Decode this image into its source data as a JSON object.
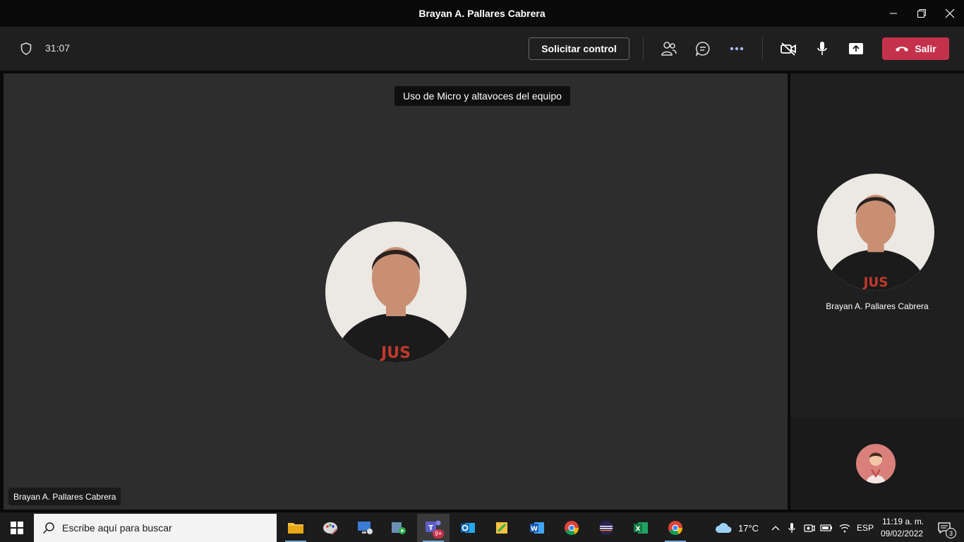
{
  "window": {
    "title": "Brayan A. Pallares Cabrera"
  },
  "toolbar": {
    "timer": "31:07",
    "request_control_label": "Solicitar control",
    "leave_label": "Salir"
  },
  "stage": {
    "tooltip": "Uso de Micro y altavoces del equipo",
    "participant_name": "Brayan A. Pallares Cabrera"
  },
  "side_panel": {
    "participant_name": "Brayan A. Pallares Cabrera"
  },
  "taskbar": {
    "search_placeholder": "Escribe aquí para buscar",
    "teams_badge": "9+",
    "weather": "17°C",
    "language": "ESP",
    "time": "11:19 a. m.",
    "date": "09/02/2022",
    "notification_count": "3"
  },
  "colors": {
    "leave_button": "#c4314b",
    "stage_bg": "#2d2d2d",
    "toolbar_bg": "#1f1f1f"
  }
}
